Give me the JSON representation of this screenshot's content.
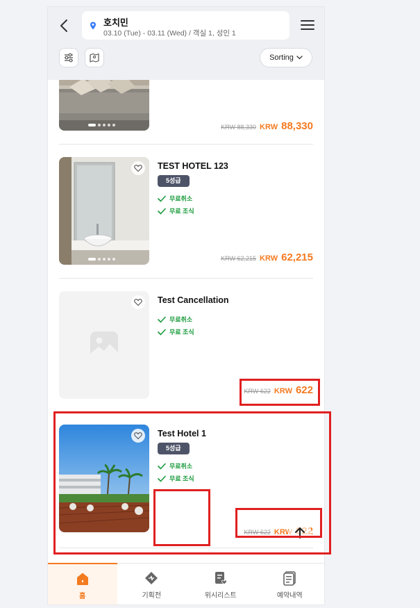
{
  "header": {
    "location": "호치민",
    "dates": "03.10 (Tue) - 03.11 (Wed) / 객실 1, 성인 1",
    "sort_label": "Sorting"
  },
  "hotels": [
    {
      "name": "",
      "old_price": "KRW 88,330",
      "currency": "KRW",
      "price": "88,330"
    },
    {
      "name": "TEST HOTEL 123",
      "badge": "5성급",
      "perks": [
        "무료취소",
        "무료 조식"
      ],
      "old_price": "KRW 62,215",
      "currency": "KRW",
      "price": "62,215"
    },
    {
      "name": "Test Cancellation",
      "perks": [
        "무료취소",
        "무료 조식"
      ],
      "old_price": "KRW 622",
      "currency": "KRW",
      "price": "622"
    },
    {
      "name": "Test Hotel 1",
      "badge": "5성급",
      "perks": [
        "무료취소",
        "무료 조식"
      ],
      "old_price": "KRW 622",
      "currency": "KRW",
      "price": "622"
    }
  ],
  "nav": {
    "items": [
      {
        "label": "홈",
        "icon": "home-icon"
      },
      {
        "label": "기획전",
        "icon": "promotion-icon"
      },
      {
        "label": "위시리스트",
        "icon": "wishlist-icon"
      },
      {
        "label": "예약내역",
        "icon": "reservation-icon"
      }
    ],
    "active": "홈"
  },
  "colors": {
    "accent": "#f47a20",
    "perk": "#179a3a",
    "badge": "#4e5468",
    "annotation": "#e02020"
  }
}
